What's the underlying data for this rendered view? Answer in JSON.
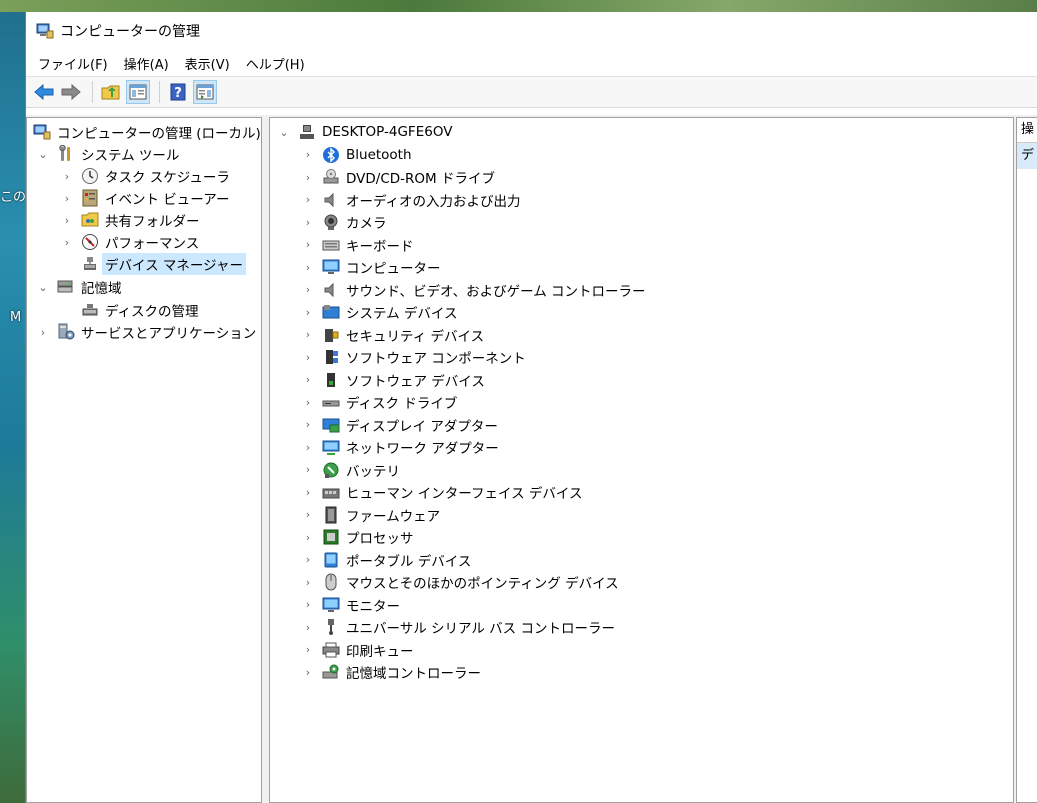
{
  "desktop": {
    "fragment_1": "この",
    "fragment_2": "M"
  },
  "window": {
    "title": "コンピューターの管理"
  },
  "menu": [
    {
      "label": "ファイル(F)"
    },
    {
      "label": "操作(A)"
    },
    {
      "label": "表示(V)"
    },
    {
      "label": "ヘルプ(H)"
    }
  ],
  "toolbar": {
    "icons": [
      "back-arrow-icon",
      "forward-arrow-icon",
      "up-folder-icon",
      "show-hide-console-tree-icon",
      "help-icon",
      "show-hide-action-pane-icon"
    ]
  },
  "left_tree": {
    "root": "コンピューターの管理 (ローカル)",
    "system_tools": "システム ツール",
    "task_scheduler": "タスク スケジューラ",
    "event_viewer": "イベント ビューアー",
    "shared_folders": "共有フォルダー",
    "performance": "パフォーマンス",
    "device_manager": "デバイス マネージャー",
    "storage": "記憶域",
    "disk_management": "ディスクの管理",
    "services_apps": "サービスとアプリケーション"
  },
  "device_tree": {
    "computer": "DESKTOP-4GFE6OV",
    "categories": [
      {
        "label": "Bluetooth",
        "icon": "bluetooth-icon"
      },
      {
        "label": "DVD/CD-ROM ドライブ",
        "icon": "dvd-drive-icon"
      },
      {
        "label": "オーディオの入力および出力",
        "icon": "speaker-icon"
      },
      {
        "label": "カメラ",
        "icon": "camera-icon"
      },
      {
        "label": "キーボード",
        "icon": "keyboard-icon"
      },
      {
        "label": "コンピューター",
        "icon": "computer-icon"
      },
      {
        "label": "サウンド、ビデオ、およびゲーム コントローラー",
        "icon": "sound-icon"
      },
      {
        "label": "システム デバイス",
        "icon": "system-device-icon"
      },
      {
        "label": "セキュリティ デバイス",
        "icon": "security-device-icon"
      },
      {
        "label": "ソフトウェア コンポーネント",
        "icon": "software-component-icon"
      },
      {
        "label": "ソフトウェア デバイス",
        "icon": "software-device-icon"
      },
      {
        "label": "ディスク ドライブ",
        "icon": "disk-drive-icon"
      },
      {
        "label": "ディスプレイ アダプター",
        "icon": "display-adapter-icon"
      },
      {
        "label": "ネットワーク アダプター",
        "icon": "network-adapter-icon"
      },
      {
        "label": "バッテリ",
        "icon": "battery-icon"
      },
      {
        "label": "ヒューマン インターフェイス デバイス",
        "icon": "hid-icon"
      },
      {
        "label": "ファームウェア",
        "icon": "firmware-icon"
      },
      {
        "label": "プロセッサ",
        "icon": "processor-icon"
      },
      {
        "label": "ポータブル デバイス",
        "icon": "portable-device-icon"
      },
      {
        "label": "マウスとそのほかのポインティング デバイス",
        "icon": "mouse-icon"
      },
      {
        "label": "モニター",
        "icon": "monitor-icon"
      },
      {
        "label": "ユニバーサル シリアル バス コントローラー",
        "icon": "usb-icon"
      },
      {
        "label": "印刷キュー",
        "icon": "printer-icon"
      },
      {
        "label": "記憶域コントローラー",
        "icon": "storage-controller-icon"
      }
    ]
  },
  "actions_pane": {
    "header": "操",
    "item": "デ"
  }
}
